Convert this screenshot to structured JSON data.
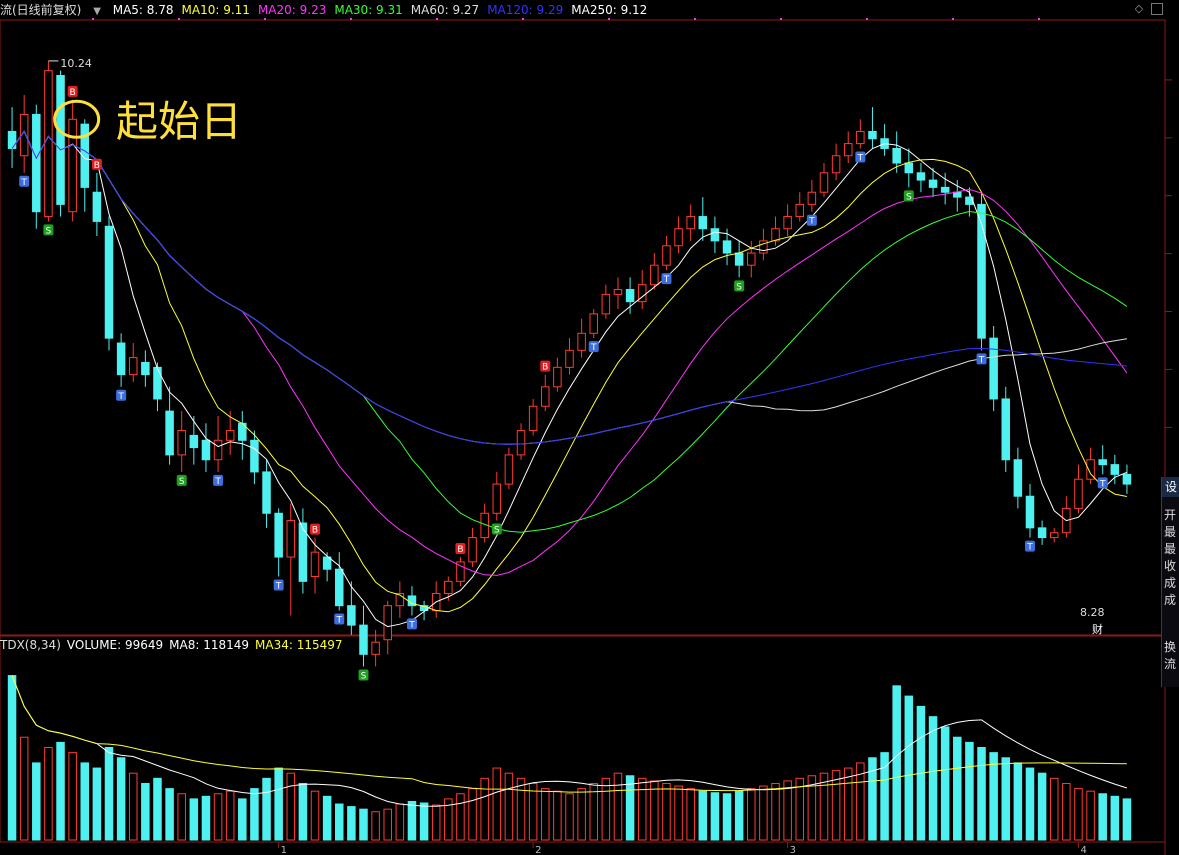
{
  "header": {
    "title": "流(日线前复权)",
    "ma_items": [
      {
        "label": "MA5: 8.78",
        "color": "#ffffff"
      },
      {
        "label": "MA10: 9.11",
        "color": "#ffff33"
      },
      {
        "label": "MA20: 9.23",
        "color": "#ff33ff"
      },
      {
        "label": "MA30: 9.31",
        "color": "#33ff33"
      },
      {
        "label": "MA60: 9.27",
        "color": "#dddddd"
      },
      {
        "label": "MA120: 9.29",
        "color": "#3333ff"
      },
      {
        "label": "MA250: 9.12",
        "color": "#ffffff"
      }
    ],
    "dropdown_icon": "triangle-down-icon",
    "diamond_icon": "diamond-icon",
    "box_icon": "square-icon"
  },
  "annotation": {
    "text": "起始日",
    "color": "#ffe03a"
  },
  "volume_header": [
    {
      "label": "TDX(8,34)",
      "color": "#dddddd"
    },
    {
      "label": "VOLUME: 99649",
      "color": "#ffffff"
    },
    {
      "label": "MA8: 118149",
      "color": "#ffffff"
    },
    {
      "label": "MA34: 115497",
      "color": "#ffff33"
    }
  ],
  "side_panel": {
    "tab": "设",
    "items": [
      "开",
      "最",
      "最",
      "收",
      "成",
      "成",
      "换",
      "流"
    ]
  },
  "colors": {
    "up": "#ff3b30",
    "down": "#4ff0f0",
    "buy": "#e02020",
    "sell": "#20a020",
    "t": "#3d6ee0"
  },
  "chart_data": {
    "type": "candlestick",
    "price_labels": {
      "high": "10.24",
      "low": "8.28"
    },
    "finance_marker": "财",
    "x_ticks": [
      "1",
      "2",
      "3",
      "4"
    ],
    "x_tick_index": [
      22,
      43,
      64,
      88
    ],
    "ylim": [
      7.9,
      10.4
    ],
    "candles": [
      [
        9.95,
        9.88,
        10.05,
        9.8
      ],
      [
        9.85,
        10.02,
        10.1,
        9.78
      ],
      [
        10.02,
        9.62,
        10.06,
        9.55
      ],
      [
        9.6,
        10.2,
        10.24,
        9.58
      ],
      [
        10.18,
        9.65,
        10.2,
        9.6
      ],
      [
        9.62,
        10.0,
        10.08,
        9.58
      ],
      [
        9.98,
        9.72,
        10.0,
        9.62
      ],
      [
        9.7,
        9.58,
        9.78,
        9.52
      ],
      [
        9.56,
        9.1,
        9.6,
        9.05
      ],
      [
        9.08,
        8.95,
        9.12,
        8.9
      ],
      [
        8.95,
        9.02,
        9.08,
        8.92
      ],
      [
        9.0,
        8.95,
        9.05,
        8.9
      ],
      [
        8.98,
        8.85,
        9.0,
        8.8
      ],
      [
        8.8,
        8.62,
        8.9,
        8.58
      ],
      [
        8.62,
        8.72,
        8.8,
        8.55
      ],
      [
        8.7,
        8.65,
        8.78,
        8.58
      ],
      [
        8.68,
        8.6,
        8.75,
        8.55
      ],
      [
        8.6,
        8.68,
        8.78,
        8.55
      ],
      [
        8.68,
        8.72,
        8.8,
        8.62
      ],
      [
        8.75,
        8.68,
        8.8,
        8.6
      ],
      [
        8.68,
        8.55,
        8.72,
        8.5
      ],
      [
        8.55,
        8.38,
        8.6,
        8.32
      ],
      [
        8.38,
        8.2,
        8.4,
        8.12
      ],
      [
        8.2,
        8.35,
        8.42,
        7.96
      ],
      [
        8.34,
        8.1,
        8.4,
        8.05
      ],
      [
        8.12,
        8.22,
        8.28,
        8.05
      ],
      [
        8.2,
        8.15,
        8.22,
        8.1
      ],
      [
        8.15,
        8.0,
        8.22,
        7.98
      ],
      [
        8.0,
        7.92,
        8.1,
        7.88
      ],
      [
        7.92,
        7.8,
        8.0,
        7.75
      ],
      [
        7.8,
        7.85,
        7.9,
        7.75
      ],
      [
        7.86,
        8.0,
        8.02,
        7.8
      ],
      [
        8.0,
        8.05,
        8.1,
        7.95
      ],
      [
        8.04,
        8.0,
        8.08,
        7.96
      ],
      [
        8.0,
        7.98,
        8.02,
        7.94
      ],
      [
        7.98,
        8.05,
        8.1,
        7.95
      ],
      [
        8.05,
        8.1,
        8.12,
        8.02
      ],
      [
        8.1,
        8.18,
        8.2,
        8.08
      ],
      [
        8.18,
        8.28,
        8.32,
        8.16
      ],
      [
        8.28,
        8.38,
        8.42,
        8.26
      ],
      [
        8.38,
        8.5,
        8.55,
        8.35
      ],
      [
        8.5,
        8.62,
        8.65,
        8.48
      ],
      [
        8.62,
        8.72,
        8.75,
        8.6
      ],
      [
        8.72,
        8.82,
        8.85,
        8.7
      ],
      [
        8.82,
        8.9,
        8.95,
        8.8
      ],
      [
        8.9,
        8.98,
        9.02,
        8.88
      ],
      [
        8.98,
        9.05,
        9.1,
        8.95
      ],
      [
        9.05,
        9.12,
        9.18,
        9.02
      ],
      [
        9.12,
        9.2,
        9.22,
        9.1
      ],
      [
        9.2,
        9.28,
        9.32,
        9.18
      ],
      [
        9.28,
        9.3,
        9.35,
        9.22
      ],
      [
        9.3,
        9.25,
        9.35,
        9.2
      ],
      [
        9.25,
        9.32,
        9.38,
        9.22
      ],
      [
        9.32,
        9.4,
        9.45,
        9.3
      ],
      [
        9.4,
        9.48,
        9.52,
        9.38
      ],
      [
        9.48,
        9.55,
        9.6,
        9.45
      ],
      [
        9.55,
        9.6,
        9.65,
        9.5
      ],
      [
        9.6,
        9.55,
        9.68,
        9.5
      ],
      [
        9.55,
        9.5,
        9.6,
        9.45
      ],
      [
        9.5,
        9.45,
        9.55,
        9.4
      ],
      [
        9.45,
        9.4,
        9.5,
        9.35
      ],
      [
        9.4,
        9.45,
        9.5,
        9.35
      ],
      [
        9.45,
        9.5,
        9.55,
        9.42
      ],
      [
        9.5,
        9.55,
        9.6,
        9.48
      ],
      [
        9.55,
        9.6,
        9.65,
        9.52
      ],
      [
        9.6,
        9.65,
        9.7,
        9.58
      ],
      [
        9.65,
        9.7,
        9.75,
        9.62
      ],
      [
        9.7,
        9.78,
        9.82,
        9.68
      ],
      [
        9.78,
        9.85,
        9.9,
        9.75
      ],
      [
        9.85,
        9.9,
        9.95,
        9.82
      ],
      [
        9.9,
        9.95,
        10.0,
        9.88
      ],
      [
        9.95,
        9.92,
        10.05,
        9.88
      ],
      [
        9.92,
        9.88,
        9.98,
        9.85
      ],
      [
        9.88,
        9.82,
        9.95,
        9.78
      ],
      [
        9.82,
        9.78,
        9.88,
        9.72
      ],
      [
        9.78,
        9.75,
        9.82,
        9.7
      ],
      [
        9.75,
        9.72,
        9.8,
        9.68
      ],
      [
        9.72,
        9.7,
        9.78,
        9.65
      ],
      [
        9.7,
        9.68,
        9.75,
        9.62
      ],
      [
        9.68,
        9.65,
        9.72,
        9.6
      ],
      [
        9.65,
        9.1,
        9.7,
        9.05
      ],
      [
        9.1,
        8.85,
        9.15,
        8.8
      ],
      [
        8.85,
        8.6,
        8.9,
        8.55
      ],
      [
        8.6,
        8.45,
        8.65,
        8.4
      ],
      [
        8.45,
        8.32,
        8.5,
        8.28
      ],
      [
        8.32,
        8.28,
        8.35,
        8.25
      ],
      [
        8.28,
        8.3,
        8.32,
        8.26
      ],
      [
        8.3,
        8.4,
        8.45,
        8.28
      ],
      [
        8.4,
        8.52,
        8.58,
        8.38
      ],
      [
        8.52,
        8.6,
        8.65,
        8.5
      ],
      [
        8.6,
        8.58,
        8.66,
        8.54
      ],
      [
        8.58,
        8.54,
        8.62,
        8.5
      ],
      [
        8.54,
        8.5,
        8.58,
        8.46
      ]
    ],
    "volumes": [
      320,
      200,
      150,
      180,
      190,
      170,
      150,
      140,
      180,
      160,
      130,
      110,
      120,
      100,
      90,
      80,
      85,
      90,
      95,
      80,
      100,
      120,
      140,
      130,
      110,
      95,
      85,
      70,
      65,
      60,
      55,
      60,
      70,
      75,
      72,
      68,
      80,
      90,
      100,
      120,
      140,
      130,
      120,
      110,
      100,
      95,
      90,
      100,
      110,
      120,
      130,
      125,
      120,
      115,
      110,
      105,
      100,
      95,
      92,
      90,
      95,
      100,
      105,
      110,
      115,
      120,
      125,
      130,
      135,
      140,
      150,
      160,
      170,
      300,
      280,
      260,
      240,
      220,
      200,
      190,
      180,
      170,
      160,
      150,
      140,
      130,
      120,
      110,
      100,
      95,
      90,
      85,
      80,
      75,
      70,
      65,
      60,
      100,
      140,
      180
    ],
    "vol_ylim": [
      0,
      360
    ]
  }
}
